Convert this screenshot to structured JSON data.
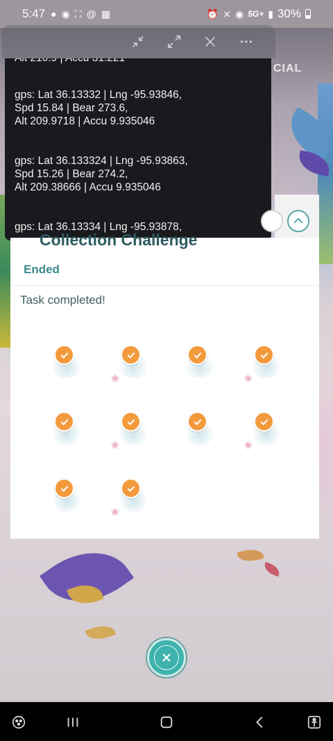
{
  "status_bar": {
    "time": "5:47",
    "network": "5G+",
    "battery": "30%"
  },
  "background": {
    "banner_text": "CIAL"
  },
  "overlay_toolbar": {
    "icons": [
      "collapse-icon",
      "expand-icon",
      "close-icon",
      "more-icon"
    ]
  },
  "log": {
    "entries": [
      "Alt 210.9 | Accu 31.221",
      "gps: Lat 36.13332 | Lng -95.93846,\nSpd 15.84 | Bear 273.6,\nAlt 209.9718 | Accu 9.935046",
      "gps: Lat 36.133324 | Lng -95.93863,\nSpd 15.26 | Bear 274.2,\nAlt 209.38666 | Accu 9.935046",
      "gps: Lat 36.13334 | Lng -95.93878,"
    ]
  },
  "card": {
    "title": "Collection Challenge",
    "status": "Ended",
    "task_text": "Task completed!",
    "items_completed": 10
  },
  "colors": {
    "accent_teal": "#3eb3ad",
    "check_orange": "#f39a3d",
    "title_teal": "#2d5b60"
  }
}
